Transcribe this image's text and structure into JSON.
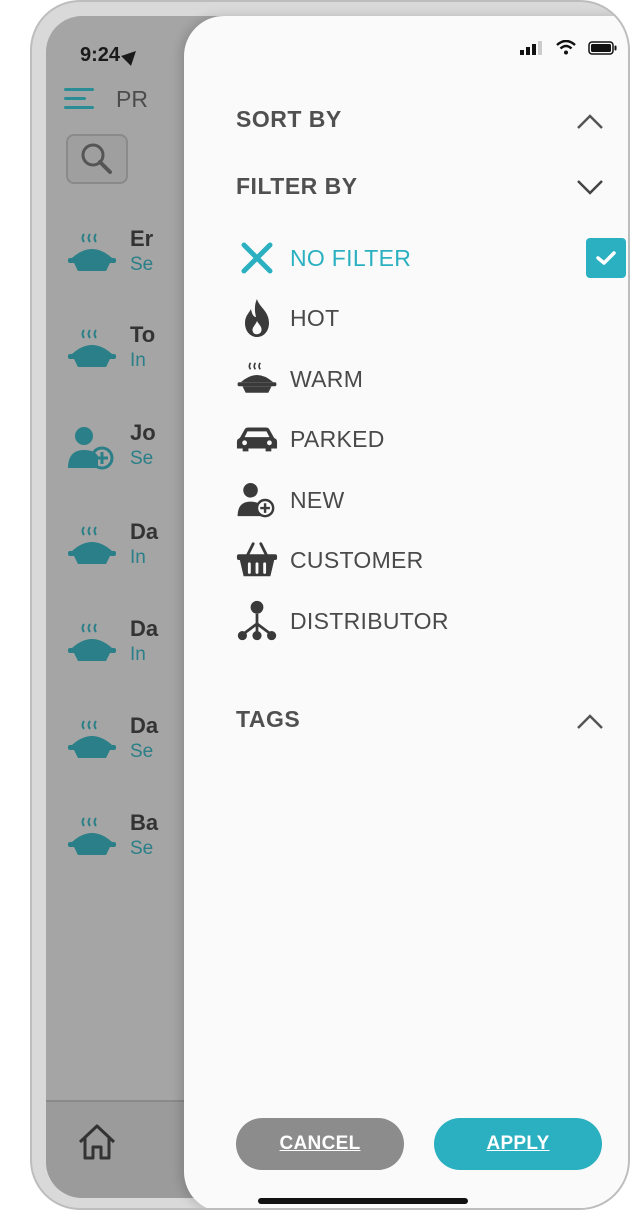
{
  "status": {
    "time": "9:24"
  },
  "app": {
    "title": "PR"
  },
  "background_rows": [
    {
      "name": "Er",
      "sub": "Se"
    },
    {
      "name": "To",
      "sub": "In"
    },
    {
      "name": "Jo",
      "sub": "Se"
    },
    {
      "name": "Da",
      "sub": "In"
    },
    {
      "name": "Da",
      "sub": "In"
    },
    {
      "name": "Da",
      "sub": "Se"
    },
    {
      "name": "Ba",
      "sub": "Se"
    }
  ],
  "drawer": {
    "sort_by": "SORT BY",
    "filter_by": "FILTER BY",
    "tags": "TAGS",
    "filters": [
      {
        "label": "NO FILTER",
        "icon": "x-icon",
        "selected": true
      },
      {
        "label": "HOT",
        "icon": "fire-icon",
        "selected": false
      },
      {
        "label": "WARM",
        "icon": "pie-icon",
        "selected": false
      },
      {
        "label": "PARKED",
        "icon": "car-icon",
        "selected": false
      },
      {
        "label": "NEW",
        "icon": "add-user-icon",
        "selected": false
      },
      {
        "label": "CUSTOMER",
        "icon": "basket-icon",
        "selected": false
      },
      {
        "label": "DISTRIBUTOR",
        "icon": "hierarchy-icon",
        "selected": false
      }
    ],
    "cancel_label": "CANCEL",
    "apply_label": "APPLY"
  },
  "colors": {
    "accent": "#2bb0c1",
    "text": "#4a4a4a",
    "cancel": "#8c8c8c",
    "icon_dark": "#3a3a3a",
    "bg_icon": "#2a7f88"
  }
}
